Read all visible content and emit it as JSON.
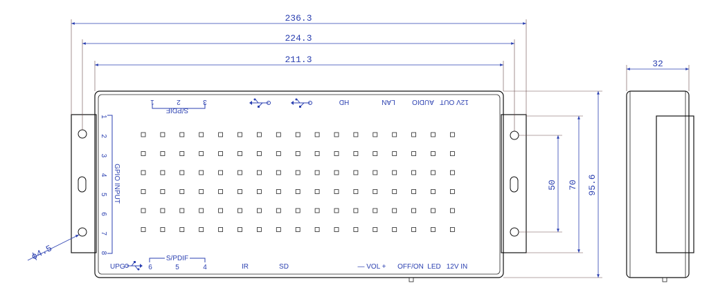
{
  "dimensions": {
    "overall_width": "236.3",
    "hole_spacing": "224.3",
    "body_width": "211.3",
    "side_depth": "32",
    "height_inner": "50",
    "height_mid": "70",
    "height_total": "95.6",
    "hole_diameter": "ϕ4.5"
  },
  "top_labels": {
    "spdif_group": "S/PDIF",
    "spdif_1": "1",
    "spdif_2": "2",
    "spdif_3": "3",
    "hd": "HD",
    "lan": "LAN",
    "audio": "AUDIO",
    "twelve_v_out": "12V OUT"
  },
  "left_labels": {
    "gpio_group": "GPIO INPUT",
    "pins": [
      "1",
      "2",
      "3",
      "4",
      "5",
      "6",
      "7",
      "8"
    ]
  },
  "bottom_labels": {
    "upg": "UPG",
    "spdif_group": "S/PDIF",
    "spdif_6": "6",
    "spdif_5": "5",
    "spdif_4": "4",
    "ir": "IR",
    "sd": "SD",
    "vol": "— VOL +",
    "off_on": "OFF/ON",
    "led": "LED",
    "twelve_v_in": "12V IN"
  },
  "icons": {
    "usb_top_1": "usb-icon",
    "usb_top_2": "usb-icon",
    "usb_bottom": "usb-icon"
  },
  "colors": {
    "dimension": "#2a3fb0",
    "outline": "#111111"
  }
}
